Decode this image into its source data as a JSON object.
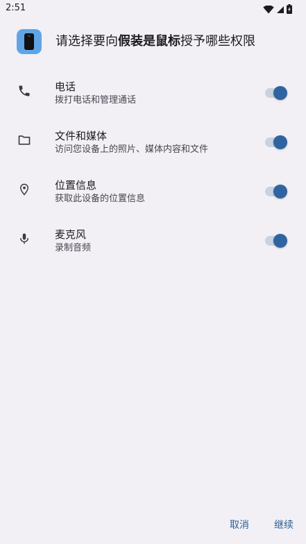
{
  "status_bar": {
    "time": "2:51",
    "icons": [
      "wifi-icon",
      "signal-icon",
      "battery-charging-icon"
    ]
  },
  "header": {
    "title_prefix": "请选择要向",
    "app_name": "假装是鼠标",
    "title_suffix": "授予哪些权限",
    "app_icon": "phone-app-icon"
  },
  "permissions": [
    {
      "icon": "phone-icon",
      "title": "电话",
      "description": "拨打电话和管理通话",
      "enabled": true
    },
    {
      "icon": "folder-icon",
      "title": "文件和媒体",
      "description": "访问您设备上的照片、媒体内容和文件",
      "enabled": true
    },
    {
      "icon": "location-icon",
      "title": "位置信息",
      "description": "获取此设备的位置信息",
      "enabled": true
    },
    {
      "icon": "microphone-icon",
      "title": "麦克风",
      "description": "录制音频",
      "enabled": true
    }
  ],
  "footer": {
    "cancel_label": "取消",
    "continue_label": "继续"
  },
  "colors": {
    "background": "#f2f0f5",
    "accent": "#2e64a0",
    "toggle_track": "#c9d2de",
    "app_icon_bg": "#5fa5e6"
  }
}
